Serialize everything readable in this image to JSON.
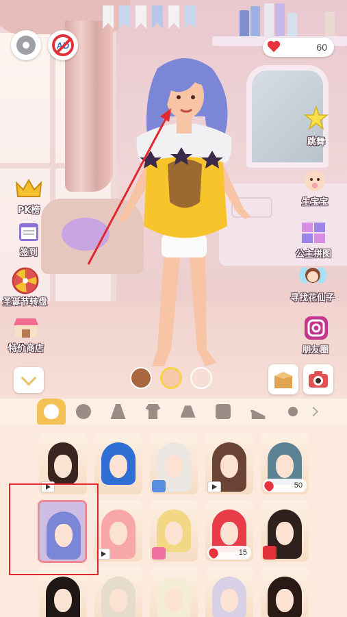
{
  "hud": {
    "hearts": "60"
  },
  "features_left": [
    {
      "label": "PK榜",
      "icon": "crown-icon"
    },
    {
      "label": "签到",
      "icon": "calendar-icon"
    },
    {
      "label": "圣诞节转盘",
      "icon": "wheel-icon"
    },
    {
      "label": "特价商店",
      "icon": "shop-icon"
    }
  ],
  "features_right": [
    {
      "label": "跳舞",
      "icon": "dance-icon"
    },
    {
      "label": "生宝宝",
      "icon": "baby-icon"
    },
    {
      "label": "公主拼图",
      "icon": "puzzle-icon"
    },
    {
      "label": "寻找花仙子",
      "icon": "fairy-icon"
    },
    {
      "label": "朋友圈",
      "icon": "instagram-icon"
    }
  ],
  "skin_tones": [
    {
      "name": "dark",
      "color": "#a9673f"
    },
    {
      "name": "light",
      "color": "#f8c6a8"
    },
    {
      "name": "pale",
      "color": "#f7dfd6"
    }
  ],
  "category_tabs": [
    "hair",
    "makeup",
    "dress",
    "top",
    "skirt",
    "bag",
    "shoes",
    "accessories"
  ],
  "hair_items": [
    [
      {
        "color": "#3b2520",
        "badge": "video",
        "price": ""
      },
      {
        "color": "#2f6fd3",
        "badge": "",
        "price": ""
      },
      {
        "color": "#eae7e2",
        "badge": "circle",
        "price": ""
      },
      {
        "color": "#6b4334",
        "badge": "video",
        "price": ""
      },
      {
        "color": "#5c8294",
        "badge": "price",
        "price": "50"
      }
    ],
    [
      {
        "color": "#7c86d6",
        "badge": "",
        "price": "",
        "selected": true
      },
      {
        "color": "#f7a7a7",
        "badge": "video",
        "price": ""
      },
      {
        "color": "#f2d784",
        "badge": "shop",
        "price": ""
      },
      {
        "color": "#e83c49",
        "badge": "price",
        "price": "15"
      },
      {
        "color": "#2e201d",
        "badge": "gift",
        "price": ""
      }
    ],
    [
      {
        "color": "#1e1715",
        "badge": "",
        "price": ""
      },
      {
        "color": "#e6dccb",
        "badge": "",
        "price": ""
      },
      {
        "color": "#f5ecd5",
        "badge": "",
        "price": ""
      },
      {
        "color": "#d8d0e6",
        "badge": "",
        "price": ""
      },
      {
        "color": "#2a1a15",
        "badge": "",
        "price": ""
      }
    ]
  ]
}
